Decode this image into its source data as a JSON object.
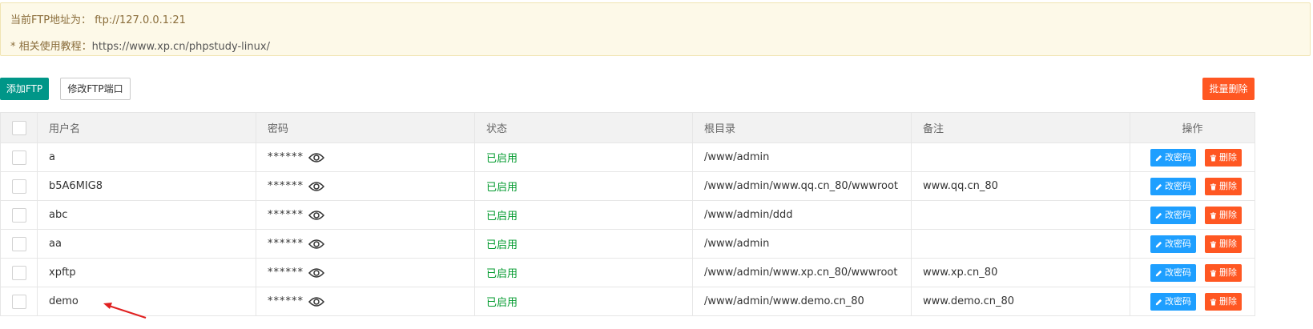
{
  "notice": {
    "ftp_addr": "当前FTP地址为： ftp://127.0.0.1:21",
    "tutorial_label": "* 相关使用教程：",
    "tutorial_url": "https://www.xp.cn/phpstudy-linux/"
  },
  "toolbar": {
    "add_label": "添加FTP",
    "port_label": "修改FTP端口",
    "batch_delete_label": "批量删除"
  },
  "table": {
    "headers": {
      "username": "用户名",
      "password": "密码",
      "status": "状态",
      "rootdir": "根目录",
      "remark": "备注",
      "actions": "操作"
    },
    "rows": [
      {
        "username": "a",
        "password": "******",
        "status": "已启用",
        "rootdir": "/www/admin",
        "remark": ""
      },
      {
        "username": "b5A6MIG8",
        "password": "******",
        "status": "已启用",
        "rootdir": "/www/admin/www.qq.cn_80/wwwroot",
        "remark": "www.qq.cn_80"
      },
      {
        "username": "abc",
        "password": "******",
        "status": "已启用",
        "rootdir": "/www/admin/ddd",
        "remark": ""
      },
      {
        "username": "aa",
        "password": "******",
        "status": "已启用",
        "rootdir": "/www/admin",
        "remark": ""
      },
      {
        "username": "xpftp",
        "password": "******",
        "status": "已启用",
        "rootdir": "/www/admin/www.xp.cn_80/wwwroot",
        "remark": "www.xp.cn_80"
      },
      {
        "username": "demo",
        "password": "******",
        "status": "已启用",
        "rootdir": "/www/admin/www.demo.cn_80",
        "remark": "www.demo.cn_80"
      }
    ],
    "change_pwd_label": "改密码",
    "delete_label": "删除"
  },
  "colors": {
    "primary": "#009688",
    "danger": "#ff5722",
    "info": "#1e9fff",
    "success": "#009a2d",
    "notice_bg": "#fdf9e8"
  },
  "icons": [
    "eye-icon",
    "edit-icon",
    "trash-icon",
    "arrow-annotation"
  ]
}
